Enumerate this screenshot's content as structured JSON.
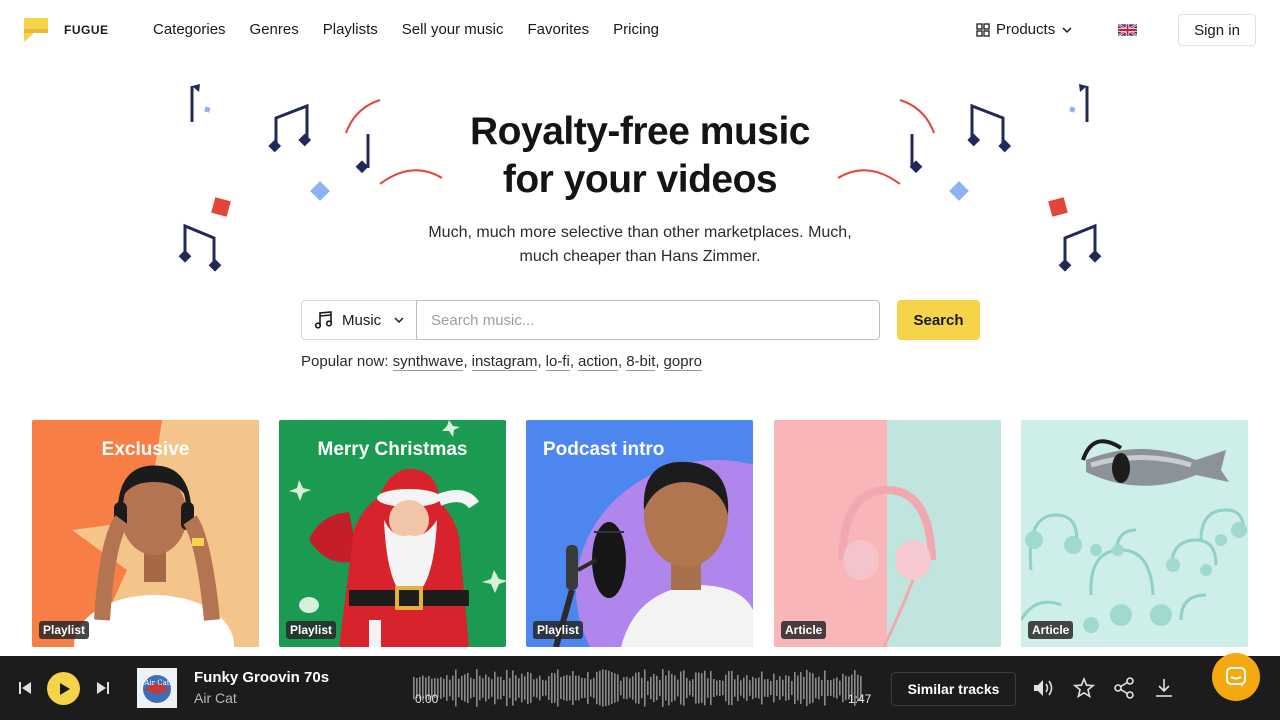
{
  "header": {
    "logo_text": "FUGUE",
    "nav": [
      "Categories",
      "Genres",
      "Playlists",
      "Sell your music",
      "Favorites",
      "Pricing"
    ],
    "products_label": "Products",
    "signin_label": "Sign in"
  },
  "hero": {
    "title_line1": "Royalty-free music",
    "title_line2": "for your videos",
    "subtitle_line1": "Much, much more selective than other marketplaces. Much,",
    "subtitle_line2": "much cheaper than Hans Zimmer."
  },
  "search": {
    "type_label": "Music",
    "placeholder": "Search music...",
    "button_label": "Search",
    "popular_label": "Popular now:",
    "popular_tags": [
      "synthwave",
      "instagram",
      "lo-fi",
      "action",
      "8-bit",
      "gopro"
    ]
  },
  "cards": [
    {
      "title": "Exclusive",
      "badge": "Playlist"
    },
    {
      "title": "Merry Christmas",
      "badge": "Playlist"
    },
    {
      "title": "Podcast intro",
      "badge": "Playlist"
    },
    {
      "title": "",
      "badge": "Article"
    },
    {
      "title": "",
      "badge": "Article"
    }
  ],
  "player": {
    "track_title": "Funky Groovin 70s",
    "artist": "Air Cat",
    "cover_text": "Air Cat",
    "time_current": "0:00",
    "time_total": "1:47",
    "similar_label": "Similar tracks"
  },
  "colors": {
    "accent_yellow": "#f5d44a",
    "navy_note": "#1f2a5c",
    "player_bg": "#1c1c1c",
    "chat_orange": "#f5a90f"
  }
}
